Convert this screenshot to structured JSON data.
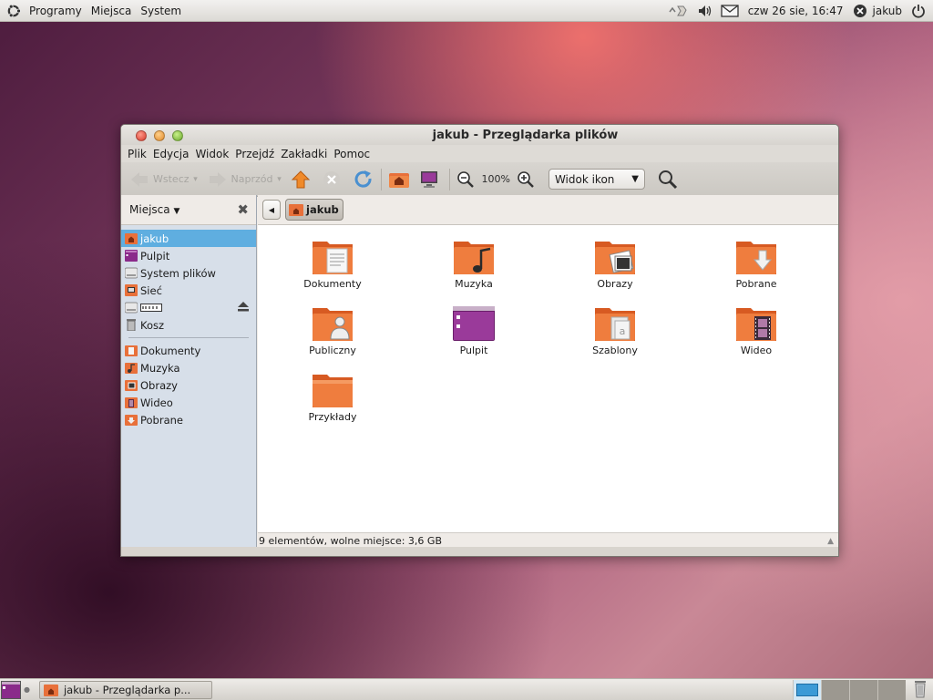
{
  "top_panel": {
    "menus": [
      "Programy",
      "Miejsca",
      "System"
    ],
    "clock": "czw 26 sie, 16:47",
    "user": "jakub"
  },
  "window": {
    "title": "jakub - Przeglądarka plików",
    "menubar": [
      {
        "label": "Plik"
      },
      {
        "label": "Edycja"
      },
      {
        "label": "Widok"
      },
      {
        "label": "Przejdź"
      },
      {
        "label": "Zakładki"
      },
      {
        "label": "Pomoc"
      }
    ],
    "toolbar": {
      "back_label": "Wstecz",
      "forward_label": "Naprzód",
      "zoom": "100%",
      "view_mode": "Widok ikon"
    },
    "sidebar": {
      "header": "Miejsca",
      "places": [
        {
          "label": "jakub",
          "icon": "home-folder-icon",
          "selected": true
        },
        {
          "label": "Pulpit",
          "icon": "desktop-icon"
        },
        {
          "label": "System plików",
          "icon": "drive-icon"
        },
        {
          "label": "Sieć",
          "icon": "network-icon"
        },
        {
          "label": "",
          "icon": "floppy-drive-icon",
          "eject": true
        },
        {
          "label": "Kosz",
          "icon": "trash-icon"
        }
      ],
      "bookmarks": [
        {
          "label": "Dokumenty",
          "icon": "documents-folder-icon"
        },
        {
          "label": "Muzyka",
          "icon": "music-folder-icon"
        },
        {
          "label": "Obrazy",
          "icon": "pictures-folder-icon"
        },
        {
          "label": "Wideo",
          "icon": "video-folder-icon"
        },
        {
          "label": "Pobrane",
          "icon": "downloads-folder-icon"
        }
      ]
    },
    "pathbar": {
      "crumb": "jakub"
    },
    "files": [
      {
        "name": "Dokumenty",
        "icon": "documents-folder-icon"
      },
      {
        "name": "Muzyka",
        "icon": "music-folder-icon"
      },
      {
        "name": "Obrazy",
        "icon": "pictures-folder-icon"
      },
      {
        "name": "Pobrane",
        "icon": "downloads-folder-icon"
      },
      {
        "name": "Publiczny",
        "icon": "public-folder-icon"
      },
      {
        "name": "Pulpit",
        "icon": "desktop-folder-icon"
      },
      {
        "name": "Szablony",
        "icon": "templates-folder-icon"
      },
      {
        "name": "Wideo",
        "icon": "video-folder-icon"
      },
      {
        "name": "Przykłady",
        "icon": "examples-folder-icon"
      }
    ],
    "status": "9 elementów, wolne miejsce: 3,6 GB"
  },
  "bottom_panel": {
    "task": "jakub - Przeglądarka p..."
  },
  "colors": {
    "selection": "#5faee0",
    "folder_orange": "#e8703a",
    "sidebar_bg": "#d7dfe9"
  }
}
